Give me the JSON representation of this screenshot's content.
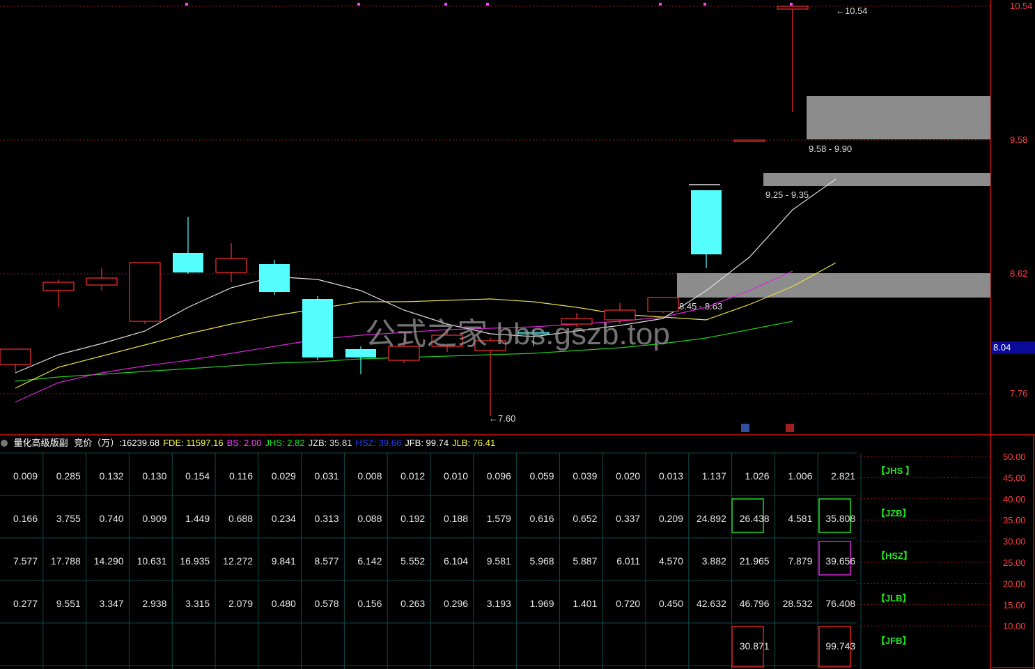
{
  "candles": [
    {
      "o": 7.97,
      "h": 8.06,
      "l": 7.92,
      "c": 8.08,
      "dir": "up"
    },
    {
      "o": 8.5,
      "h": 8.58,
      "l": 8.38,
      "c": 8.56,
      "dir": "up"
    },
    {
      "o": 8.54,
      "h": 8.66,
      "l": 8.5,
      "c": 8.59,
      "dir": "up"
    },
    {
      "o": 8.28,
      "h": 8.7,
      "l": 8.26,
      "c": 8.7,
      "dir": "up"
    },
    {
      "o": 8.77,
      "h": 9.03,
      "l": 8.62,
      "c": 8.63,
      "dir": "down"
    },
    {
      "o": 8.63,
      "h": 8.84,
      "l": 8.56,
      "c": 8.73,
      "dir": "up"
    },
    {
      "o": 8.69,
      "h": 8.72,
      "l": 8.47,
      "c": 8.49,
      "dir": "down"
    },
    {
      "o": 8.44,
      "h": 8.46,
      "l": 8.0,
      "c": 8.02,
      "dir": "down"
    },
    {
      "o": 8.08,
      "h": 8.1,
      "l": 7.9,
      "c": 8.02,
      "dir": "down"
    },
    {
      "o": 8.0,
      "h": 8.16,
      "l": 7.98,
      "c": 8.1,
      "dir": "up"
    },
    {
      "o": 8.1,
      "h": 8.22,
      "l": 8.06,
      "c": 8.18,
      "dir": "up"
    },
    {
      "o": 8.07,
      "h": 8.16,
      "l": 7.6,
      "c": 8.14,
      "dir": "up"
    },
    {
      "o": 8.2,
      "h": 8.22,
      "l": 8.1,
      "c": 8.19,
      "dir": "flat"
    },
    {
      "o": 8.26,
      "h": 8.34,
      "l": 8.24,
      "c": 8.3,
      "dir": "up"
    },
    {
      "o": 8.29,
      "h": 8.41,
      "l": 8.26,
      "c": 8.36,
      "dir": "up"
    },
    {
      "o": 8.35,
      "h": 8.45,
      "l": 8.34,
      "c": 8.45,
      "dir": "up"
    },
    {
      "o": 9.22,
      "h": 9.22,
      "l": 8.66,
      "c": 8.76,
      "dir": "down"
    },
    {
      "o": 9.58,
      "h": 9.58,
      "l": 9.58,
      "c": 9.58,
      "dir": "up"
    },
    {
      "o": 10.52,
      "h": 10.54,
      "l": 9.78,
      "c": 10.54,
      "dir": "up"
    }
  ],
  "ma": {
    "white": [
      7.91,
      8.04,
      8.12,
      8.21,
      8.38,
      8.52,
      8.6,
      8.58,
      8.5,
      8.36,
      8.26,
      8.19,
      8.17,
      8.21,
      8.25,
      8.3,
      8.5,
      8.74,
      9.08,
      9.3
    ],
    "yellow": [
      7.8,
      7.95,
      8.03,
      8.11,
      8.19,
      8.26,
      8.32,
      8.37,
      8.42,
      8.42,
      8.43,
      8.44,
      8.42,
      8.38,
      8.33,
      8.31,
      8.29,
      8.4,
      8.53,
      8.7
    ],
    "magenta": [
      7.7,
      7.84,
      7.91,
      7.96,
      8.0,
      8.05,
      8.1,
      8.15,
      8.18,
      8.2,
      8.22,
      8.23,
      8.24,
      8.26,
      8.28,
      8.31,
      8.38,
      8.5,
      8.64
    ],
    "green": [
      7.85,
      7.88,
      7.9,
      7.92,
      7.94,
      7.96,
      7.98,
      7.99,
      8.01,
      8.02,
      8.03,
      8.04,
      8.05,
      8.07,
      8.09,
      8.12,
      8.16,
      8.22,
      8.28
    ]
  },
  "zones": [
    {
      "label": "9.58 - 9.90"
    },
    {
      "label": "9.25 - 9.35"
    },
    {
      "label": "8.45 - 8.63"
    }
  ],
  "price_axis": [
    "10.54",
    "9.58",
    "8.62",
    "7.76"
  ],
  "current_price": "8.04",
  "high_label": "10.54",
  "low_label": "7.60",
  "watermark_center": "公式之家 bbs.gszb.top",
  "info_bar": {
    "title": "量化高级版副",
    "items": [
      {
        "text": "竞价（万）:16239.68",
        "color": "#ffffff"
      },
      {
        "text": "FDE: 11597.16",
        "color": "#ffff40"
      },
      {
        "text": "BS: 2.00",
        "color": "#ff40ff"
      },
      {
        "text": "JHS: 2.82",
        "color": "#22e622"
      },
      {
        "text": "JZB: 35.81",
        "color": "#e8e8e8"
      },
      {
        "text": "HSZ: 39.66",
        "color": "#2040ff"
      },
      {
        "text": "JFB: 99.74",
        "color": "#ffffff"
      },
      {
        "text": "JLB: 76.41",
        "color": "#ffff40"
      }
    ]
  },
  "table": {
    "rows": [
      [
        "0.009",
        "0.285",
        "0.132",
        "0.130",
        "0.154",
        "0.116",
        "0.029",
        "0.031",
        "0.008",
        "0.012",
        "0.010",
        "0.096",
        "0.059",
        "0.039",
        "0.020",
        "0.013",
        "1.137",
        "1.026",
        "1.006",
        "2.821"
      ],
      [
        "0.166",
        "3.755",
        "0.740",
        "0.909",
        "1.449",
        "0.688",
        "0.234",
        "0.313",
        "0.088",
        "0.192",
        "0.188",
        "1.579",
        "0.616",
        "0.652",
        "0.337",
        "0.209",
        "24.892",
        "26.438",
        "4.581",
        "35.808"
      ],
      [
        "7.577",
        "17.788",
        "14.290",
        "10.631",
        "16.935",
        "12.272",
        "9.841",
        "8.577",
        "6.142",
        "5.552",
        "6.104",
        "9.581",
        "5.968",
        "5.887",
        "6.011",
        "4.570",
        "3.882",
        "21.965",
        "7.879",
        "39.656"
      ],
      [
        "0.277",
        "9.551",
        "3.347",
        "2.938",
        "3.315",
        "2.079",
        "0.480",
        "0.578",
        "0.156",
        "0.263",
        "0.296",
        "3.193",
        "1.969",
        "1.401",
        "0.720",
        "0.450",
        "42.632",
        "46.796",
        "28.532",
        "76.408"
      ],
      [
        "",
        "",
        "",
        "",
        "",
        "",
        "",
        "",
        "",
        "",
        "",
        "",
        "",
        "",
        "",
        "",
        "",
        "30.871",
        "",
        "99.743"
      ]
    ],
    "tags": [
      "【JHS 】",
      "【JZB】",
      "【HSZ】",
      "【JLB】",
      "【JFB】"
    ]
  },
  "sub_axis": [
    "50.00",
    "45.00",
    "40.00",
    "35.00",
    "30.00",
    "25.00",
    "20.00",
    "15.00",
    "10.00"
  ],
  "colors": {
    "up": "#ff3030",
    "down": "#55ffff",
    "grid": "#0f4a4a",
    "axis": "#cc1010"
  }
}
